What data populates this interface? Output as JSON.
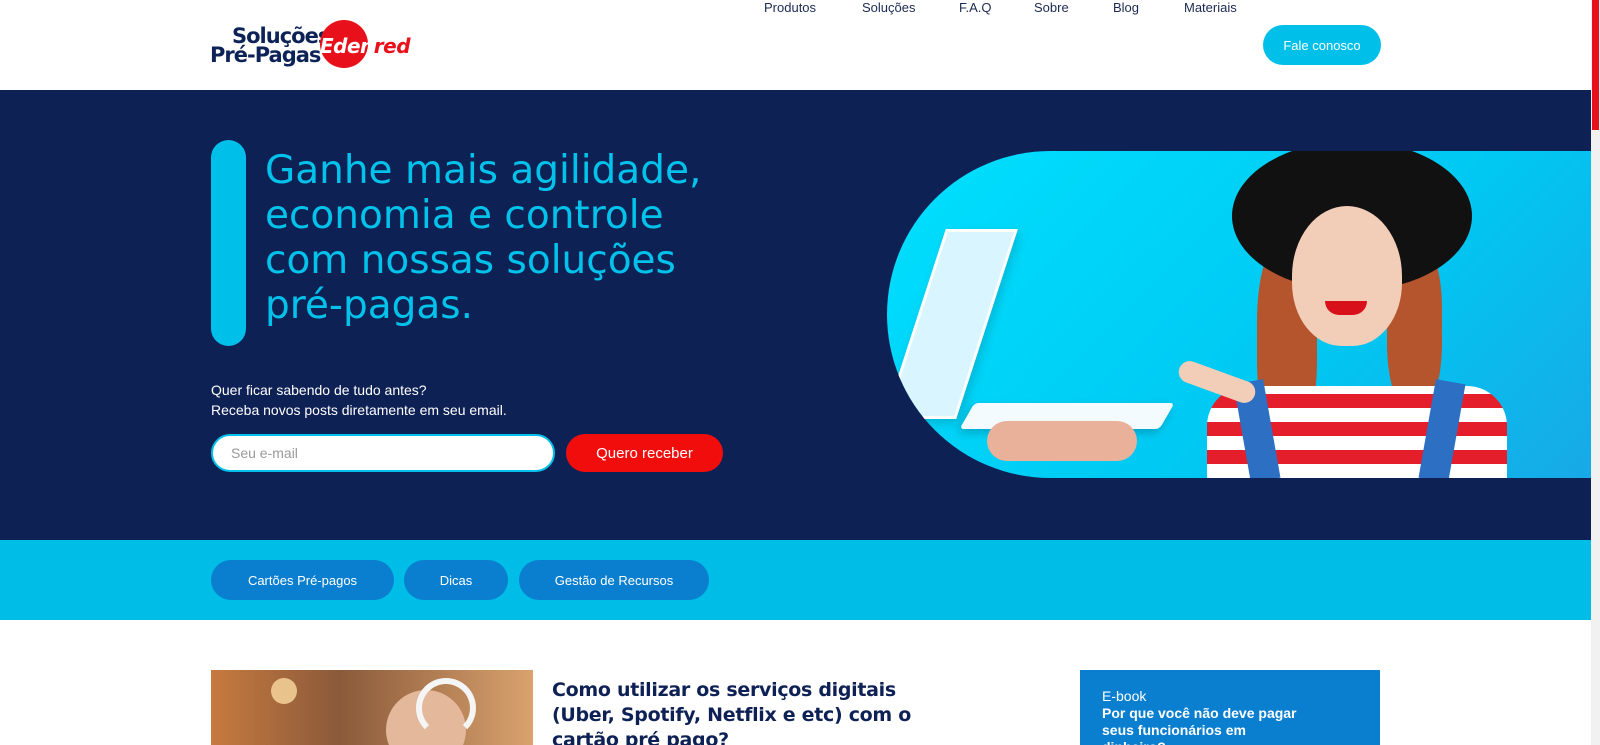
{
  "logo": {
    "line1": "Soluções",
    "line2": "Pré-Pagas",
    "brand_part1": "E",
    "brand_part2": "den",
    "brand_part3": "red"
  },
  "nav": {
    "items": [
      "Produtos",
      "Soluções",
      "F.A.Q",
      "Sobre",
      "Blog",
      "Materiais"
    ],
    "cta": "Fale conosco"
  },
  "hero": {
    "headline": "Ganhe mais agilidade, economia e controle com nossas soluções pré-pagas.",
    "subtext_line1": "Quer ficar sabendo de tudo antes?",
    "subtext_line2": "Receba novos posts diretamente em seu email.",
    "email_placeholder": "Seu e-mail",
    "submit_label": "Quero receber"
  },
  "categories": [
    "Cartões Pré-pagos",
    "Dicas",
    "Gestão de Recursos"
  ],
  "article": {
    "title": "Como utilizar os serviços digitais (Uber, Spotify, Netflix e etc) com o cartão pré pago?"
  },
  "ebook": {
    "label": "E-book",
    "title": "Por que você não deve pagar seus funcionários em dinheiro?"
  },
  "colors": {
    "navy": "#0e2155",
    "cyan": "#00c0ea",
    "red": "#e8101a",
    "blue": "#0a7fcf"
  }
}
